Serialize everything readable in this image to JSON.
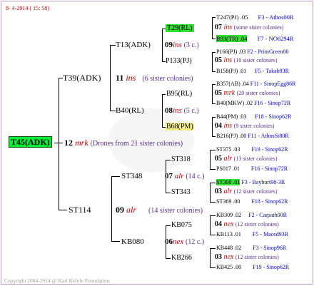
{
  "datestamp": "8- 4-2014 ( 15: 58)",
  "copyright": "Copyright 2004-2014 @ Karl Kehrle Foundation.",
  "root": {
    "name": "T45(ADK)",
    "num": "12",
    "breed": "mrk",
    "note": "(Drones from 21 sister colonies)"
  },
  "gen1": [
    {
      "name": "T39(ADK)",
      "num": "11",
      "breed": "ins",
      "note": "(6 sister colonies)"
    },
    {
      "name": "ST114",
      "num": "09",
      "breed": "alr",
      "note": "(14 sister colonies)"
    }
  ],
  "gen2": [
    {
      "name": "T13(ADK)",
      "num": "09",
      "breed": "ins",
      "note": "(3 c.)"
    },
    {
      "name": "B40(RL)",
      "num": "08",
      "breed": "ins",
      "note": "(5 c.)"
    },
    {
      "name": "ST348",
      "num": "07",
      "breed": "alr",
      "note": "(14 c.)"
    },
    {
      "name": "KB080",
      "num": "06",
      "breed": "nex",
      "note": "(12 c.)"
    }
  ],
  "gen3": [
    {
      "name": "T29(RL)",
      "num": "07",
      "breed": "ins",
      "note": "(some sister colonies)"
    },
    {
      "name": "P133(PJ)",
      "num": "05",
      "breed": "ins",
      "note": "(10 sister colonies)"
    },
    {
      "name": "B95(RL)",
      "num": "05",
      "breed": "mrk",
      "note": "(20 sister colonies)"
    },
    {
      "name": "B68(PM)",
      "num": "04",
      "breed": "ins",
      "note": "(9 sister colonies)"
    },
    {
      "name": "ST318",
      "num": "05",
      "breed": "alr",
      "note": "(13 sister colonies)"
    },
    {
      "name": "ST343",
      "num": "03",
      "breed": "alr",
      "note": "(12 sister colonies)"
    },
    {
      "name": "KB075",
      "num": "04",
      "breed": "nex",
      "note": "(12 sister colonies)"
    },
    {
      "name": "KB266",
      "num": "03",
      "breed": "nex",
      "note": "(12 sister colonies)"
    }
  ],
  "gen4": [
    {
      "name": "T247(PJ)",
      "num": ".05",
      "ref": "F3 - Athos00R"
    },
    {
      "name": "B93(TR)",
      "num": ".04",
      "ref": "F7 - NO6294R"
    },
    {
      "name": "P166(PJ)",
      "num": ".03",
      "ref": "F2 - PrimGreen00"
    },
    {
      "name": "B158(PJ)",
      "num": ".01",
      "ref": "F5 - Takab93R"
    },
    {
      "name": "B357(AB)",
      "num": ".04",
      "ref": "F11 - SinopEgg86R"
    },
    {
      "name": "B40(MKW)",
      "num": ".02",
      "ref": "F16 - Sinop72R"
    },
    {
      "name": "B44(PM)",
      "num": ".03",
      "ref": "F18 - Sinop62R"
    },
    {
      "name": "B216(PJ)",
      "num": ".00",
      "ref": "F11 - AthosSt80R"
    },
    {
      "name": "ST375",
      "num": ".03",
      "ref": "F19 - Sinop62R"
    },
    {
      "name": "PS017",
      "num": ".01",
      "ref": "F16 - Sinop72R"
    },
    {
      "name": "ST308",
      "num": ".01",
      "ref": "F3 - Bayburt98-3R"
    },
    {
      "name": "ST369",
      "num": ".00",
      "ref": "F18 - Sinop62R"
    },
    {
      "name": "KB309",
      "num": ".02",
      "ref": "F2 - Carpath00R"
    },
    {
      "name": "KB113",
      "num": ".01",
      "ref": "F5 - Maced93R"
    },
    {
      "name": "KB448",
      "num": ".02",
      "ref": "F3 - Sinop96R"
    },
    {
      "name": "KB425",
      "num": ".00",
      "ref": "F19 - Sinop62R"
    }
  ]
}
